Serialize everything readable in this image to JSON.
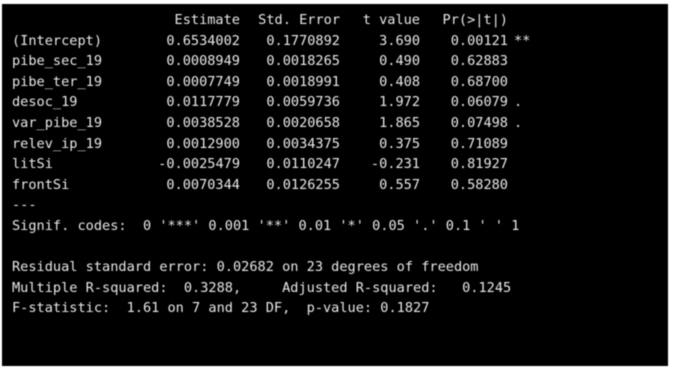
{
  "output": {
    "header": {
      "estimate": "Estimate",
      "std_error": "Std. Error",
      "t_value": "t value",
      "p_value": "Pr(>|t|)"
    },
    "rows": [
      {
        "name": "(Intercept)",
        "estimate": "0.6534002",
        "std_error": "0.1770892",
        "t_value": "3.690",
        "p_value": "0.00121",
        "signif": "**"
      },
      {
        "name": "pibe_sec_19",
        "estimate": "0.0008949",
        "std_error": "0.0018265",
        "t_value": "0.490",
        "p_value": "0.62883",
        "signif": ""
      },
      {
        "name": "pibe_ter_19",
        "estimate": "0.0007749",
        "std_error": "0.0018991",
        "t_value": "0.408",
        "p_value": "0.68700",
        "signif": ""
      },
      {
        "name": "desoc_19",
        "estimate": "0.0117779",
        "std_error": "0.0059736",
        "t_value": "1.972",
        "p_value": "0.06079",
        "signif": "."
      },
      {
        "name": "var_pibe_19",
        "estimate": "0.0038528",
        "std_error": "0.0020658",
        "t_value": "1.865",
        "p_value": "0.07498",
        "signif": "."
      },
      {
        "name": "relev_ip_19",
        "estimate": "0.0012900",
        "std_error": "0.0034375",
        "t_value": "0.375",
        "p_value": "0.71089",
        "signif": ""
      },
      {
        "name": "litSi",
        "estimate": "-0.0025479",
        "std_error": "0.0110247",
        "t_value": "-0.231",
        "p_value": "0.81927",
        "signif": ""
      },
      {
        "name": "frontSi",
        "estimate": "0.0070344",
        "std_error": "0.0126255",
        "t_value": "0.557",
        "p_value": "0.58280",
        "signif": ""
      }
    ],
    "separator": "---",
    "signif_codes": "Signif. codes:  0 '***' 0.001 '**' 0.01 '*' 0.05 '.' 0.1 ' ' 1",
    "residual_se": "Residual standard error: 0.02682 on 23 degrees of freedom",
    "r_squared": "Multiple R-squared:  0.3288,     Adjusted R-squared:   0.1245",
    "f_statistic": "F-statistic:  1.61 on 7 and 23 DF,  p-value: 0.1827"
  },
  "colors": {
    "background": "#000000",
    "text": "#e8e8e8"
  }
}
